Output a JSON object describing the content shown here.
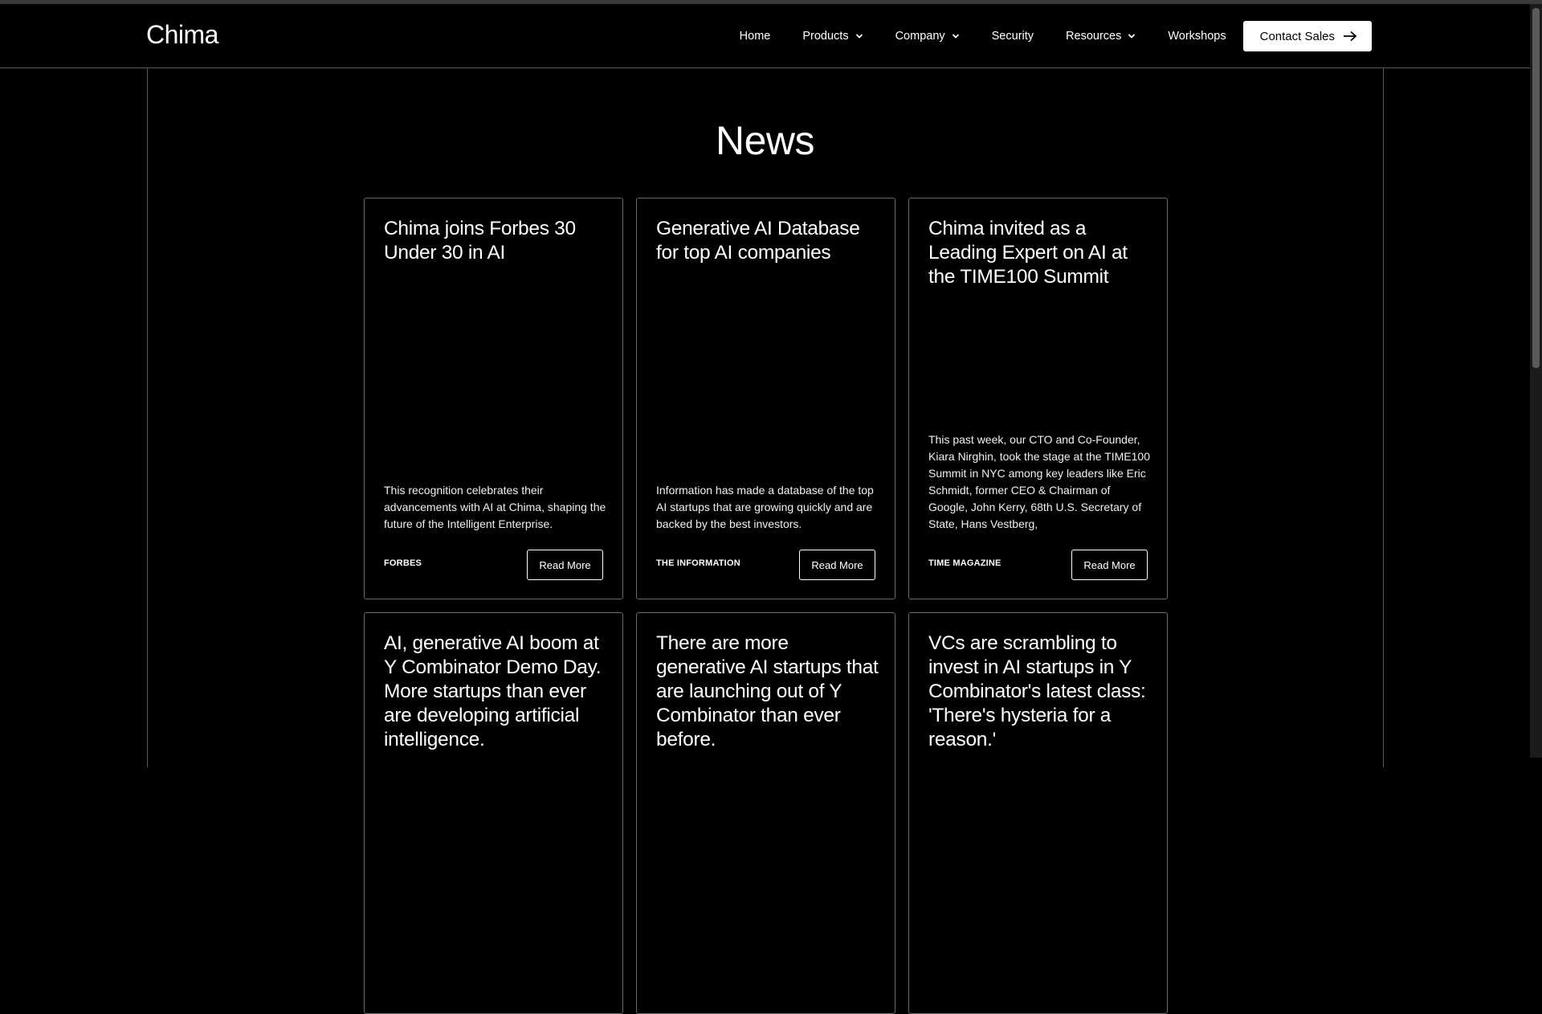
{
  "brand": {
    "logo": "Chima"
  },
  "nav": {
    "items": [
      {
        "label": "Home",
        "dropdown": false
      },
      {
        "label": "Products",
        "dropdown": true
      },
      {
        "label": "Company",
        "dropdown": true
      },
      {
        "label": "Security",
        "dropdown": false
      },
      {
        "label": "Resources",
        "dropdown": true
      },
      {
        "label": "Workshops",
        "dropdown": false
      }
    ],
    "cta": "Contact Sales"
  },
  "page": {
    "heading": "News"
  },
  "cards": [
    {
      "title": "Chima joins Forbes 30 Under 30 in AI",
      "description": "This recognition celebrates their advancements with AI at Chima, shaping the future of the Intelligent Enterprise.",
      "source": "FORBES",
      "button": "Read More"
    },
    {
      "title": "Generative AI Database for top AI companies",
      "description": "Information has made a database of the top AI startups that are growing quickly and are backed by the best investors.",
      "source": "THE INFORMATION",
      "button": "Read More"
    },
    {
      "title": "Chima invited as a Leading Expert on AI at the TIME100 Summit",
      "description": "This past week, our CTO and Co-Founder, Kiara Nirghin, took the stage at the TIME100 Summit in NYC among key leaders like Eric Schmidt, former CEO & Chairman of Google, John Kerry, 68th U.S. Secretary of State, Hans Vestberg,",
      "source": "TIME MAGAZINE",
      "button": "Read More"
    },
    {
      "title": "AI, generative AI boom at Y Combinator Demo Day. More startups than ever are developing artificial intelligence.",
      "description": "",
      "source": "",
      "button": ""
    },
    {
      "title": "There are more generative AI startups that are launching out of Y Combinator than ever before.",
      "description": "",
      "source": "",
      "button": ""
    },
    {
      "title": "VCs are scrambling to invest in AI startups in Y Combinator's latest class: 'There's hysteria for a reason.'",
      "description": "",
      "source": "",
      "button": ""
    }
  ],
  "icons": {
    "dropdown": "chevron-down-icon",
    "cta": "arrow-right-icon"
  }
}
